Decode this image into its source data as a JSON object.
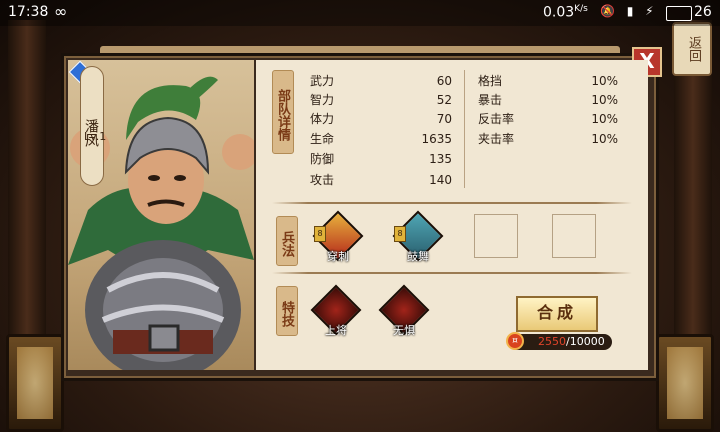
{
  "status_bar": {
    "time": "17:38",
    "speed": "0.03",
    "speed_unit": "K/s",
    "battery": "26"
  },
  "return_button": "返回",
  "close_label": "X",
  "hero": {
    "name": "潘凤",
    "level": "Lv.1"
  },
  "sections": {
    "details": "部队详情",
    "tactics": "兵法",
    "traits": "特技"
  },
  "stats_left": [
    {
      "label": "武力",
      "value": "60"
    },
    {
      "label": "智力",
      "value": "52"
    },
    {
      "label": "体力",
      "value": "70"
    },
    {
      "label": "生命",
      "value": "1635"
    },
    {
      "label": "防御",
      "value": "135"
    },
    {
      "label": "攻击",
      "value": "140"
    }
  ],
  "stats_right": [
    {
      "label": "格挡",
      "value": "10%"
    },
    {
      "label": "暴击",
      "value": "10%"
    },
    {
      "label": "反击率",
      "value": "10%"
    },
    {
      "label": "夹击率",
      "value": "10%"
    }
  ],
  "tactics": [
    {
      "name": "穿刺",
      "rank": "8"
    },
    {
      "name": "鼓舞",
      "rank": "8"
    }
  ],
  "traits": [
    {
      "name": "上将"
    },
    {
      "name": "无惧"
    }
  ],
  "synthesize_label": "合成",
  "cost": {
    "have": "2550",
    "separator": "/",
    "need": "10000"
  },
  "colors": {
    "accent_red": "#b8362c",
    "panel_bg": "#f1e7d3",
    "label_brown": "#7a3a16"
  }
}
